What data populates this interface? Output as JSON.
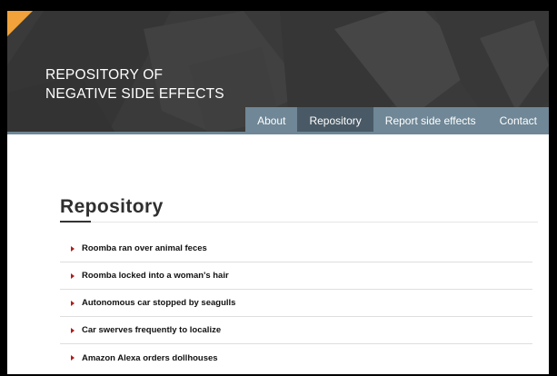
{
  "header": {
    "title_line1": "REPOSITORY OF",
    "title_line2": "NEGATIVE SIDE EFFECTS"
  },
  "nav": {
    "items": [
      {
        "label": "About",
        "active": false
      },
      {
        "label": "Repository",
        "active": true
      },
      {
        "label": "Report side effects",
        "active": false
      },
      {
        "label": "Contact",
        "active": false
      }
    ]
  },
  "main": {
    "title": "Repository",
    "items": [
      {
        "label": "Roomba ran over animal feces"
      },
      {
        "label": "Roomba locked into a woman's hair"
      },
      {
        "label": "Autonomous car stopped by seagulls"
      },
      {
        "label": "Car swerves frequently to localize"
      },
      {
        "label": "Amazon Alexa orders dollhouses"
      }
    ]
  },
  "colors": {
    "header_bg": "#3b3b3b",
    "nav_bg": "#6f8796",
    "nav_active": "#495a66",
    "accent_orange": "#f1a23a",
    "arrow_red": "#b01d1d"
  }
}
